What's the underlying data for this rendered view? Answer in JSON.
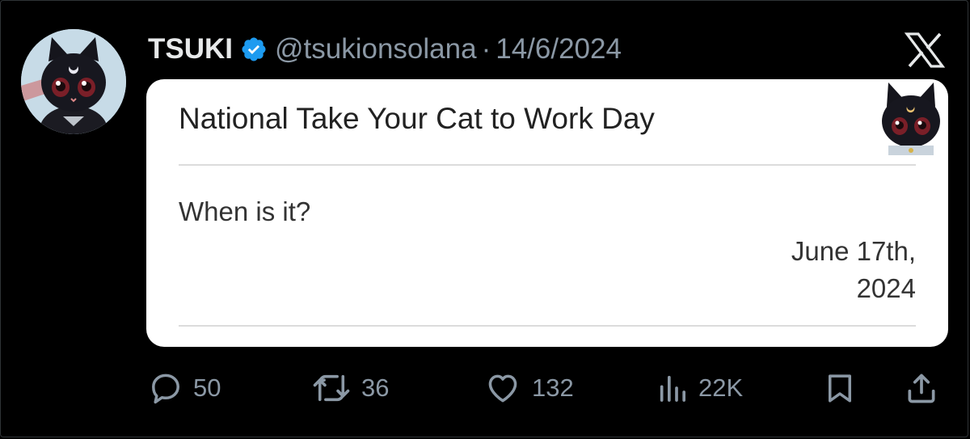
{
  "post": {
    "author_name": "TSUKI",
    "handle": "@tsukionsolana",
    "separator": "·",
    "date": "14/6/2024",
    "verified_icon": "verified-badge-icon",
    "platform_icon": "x-logo-icon"
  },
  "card": {
    "title": "National Take Your Cat to Work Day",
    "question": "When is it?",
    "answer_line1": "June 17th,",
    "answer_line2": "2024"
  },
  "actions": {
    "replies": "50",
    "reposts": "36",
    "likes": "132",
    "views": "22K",
    "reply_icon": "reply-icon",
    "repost_icon": "repost-icon",
    "like_icon": "heart-icon",
    "views_icon": "views-icon",
    "bookmark_icon": "bookmark-icon",
    "share_icon": "share-icon"
  },
  "colors": {
    "background": "#000000",
    "muted_text": "#8b98a5",
    "verified_blue": "#1d9bf0",
    "card_bg": "#ffffff"
  }
}
